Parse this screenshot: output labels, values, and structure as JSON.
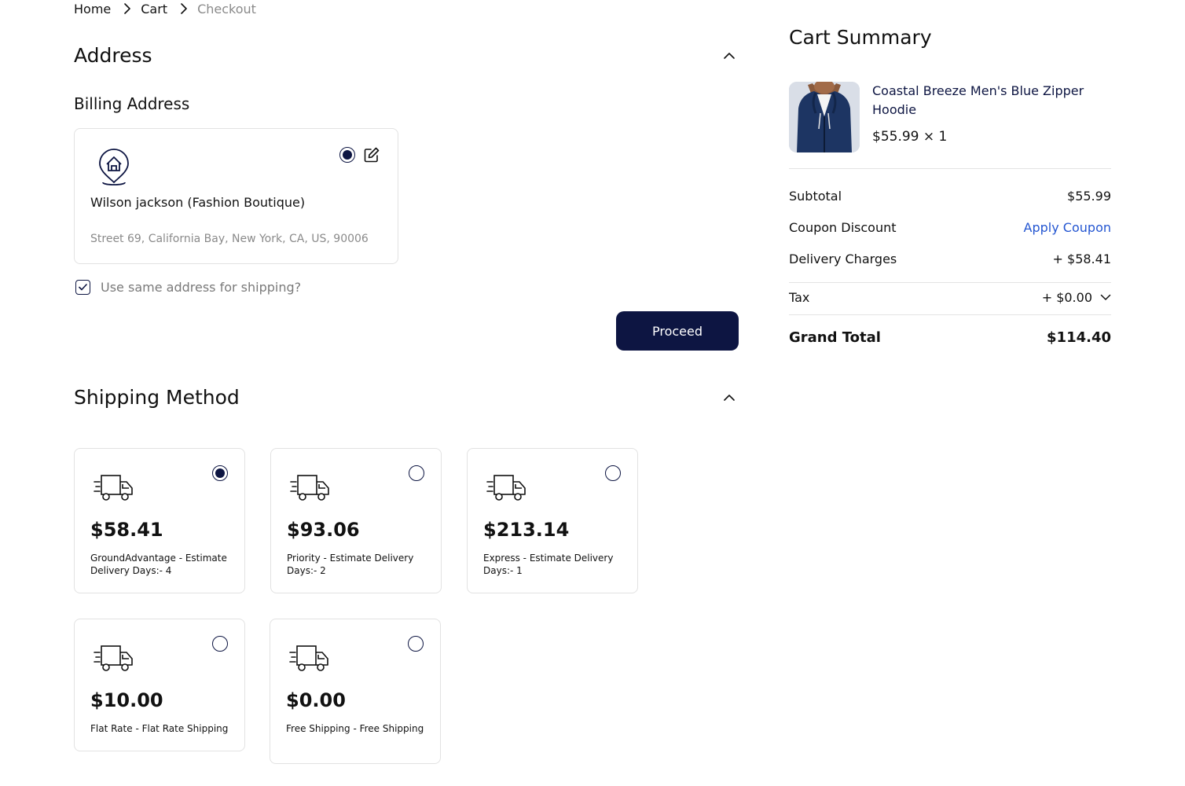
{
  "breadcrumb": {
    "home": "Home",
    "cart": "Cart",
    "checkout": "Checkout"
  },
  "address": {
    "title": "Address",
    "billing_title": "Billing Address",
    "name": "Wilson jackson (Fashion Boutique)",
    "line": "Street 69, California Bay, New York, CA, US, 90006",
    "same_address_label": "Use same address for shipping?",
    "same_address_checked": true,
    "proceed_label": "Proceed"
  },
  "shipping": {
    "title": "Shipping Method",
    "options": [
      {
        "price": "$58.41",
        "label": "GroundAdvantage - Estimate Delivery Days:- 4",
        "selected": true
      },
      {
        "price": "$93.06",
        "label": "Priority - Estimate Delivery Days:- 2",
        "selected": false
      },
      {
        "price": "$213.14",
        "label": "Express - Estimate Delivery Days:- 1",
        "selected": false
      },
      {
        "price": "$10.00",
        "label": "Flat Rate - Flat Rate Shipping",
        "selected": false
      },
      {
        "price": "$0.00",
        "label": "Free Shipping - Free Shipping",
        "selected": false
      }
    ]
  },
  "cart": {
    "title": "Cart Summary",
    "product": {
      "name": "Coastal Breeze Men's Blue Zipper Hoodie",
      "price_qty": "$55.99 × 1"
    },
    "subtotal_label": "Subtotal",
    "subtotal_value": "$55.99",
    "coupon_label": "Coupon Discount",
    "coupon_action": "Apply Coupon",
    "delivery_label": "Delivery Charges",
    "delivery_value": "+ $58.41",
    "tax_label": "Tax",
    "tax_value": "+ $0.00",
    "grand_label": "Grand Total",
    "grand_value": "$114.40"
  },
  "colors": {
    "primary": "#0d1542",
    "link": "#2456d1",
    "muted": "#8a8a8a",
    "border": "#e2e2e2"
  }
}
